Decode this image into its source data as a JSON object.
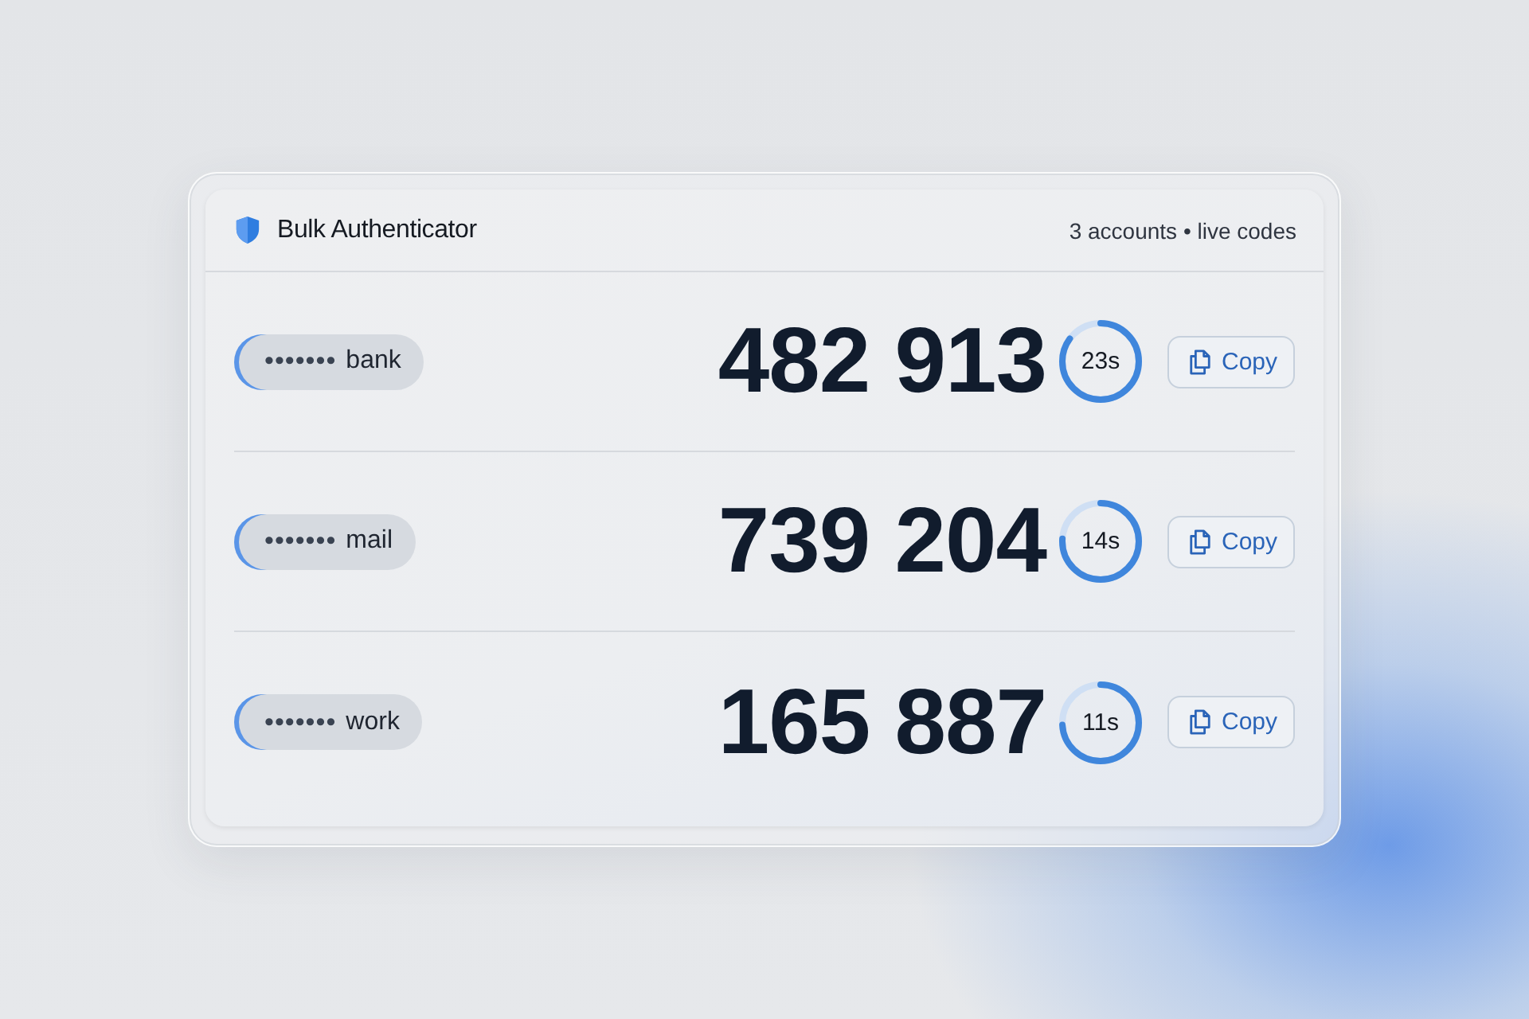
{
  "window": {
    "title": "Bulk Authenticator",
    "meta": "3 accounts • live codes"
  },
  "accounts": [
    {
      "masked": "•••••••",
      "name": "bank",
      "code": "482 913",
      "seconds": "23s",
      "level": 0.85,
      "button": "Copy"
    },
    {
      "masked": "•••••••",
      "name": "mail",
      "code": "739 204",
      "seconds": "14s",
      "level": 0.76,
      "button": "Copy"
    },
    {
      "masked": "•••••••",
      "name": "work",
      "code": "165 887",
      "seconds": "11s",
      "level": 0.74,
      "button": "Copy"
    }
  ]
}
